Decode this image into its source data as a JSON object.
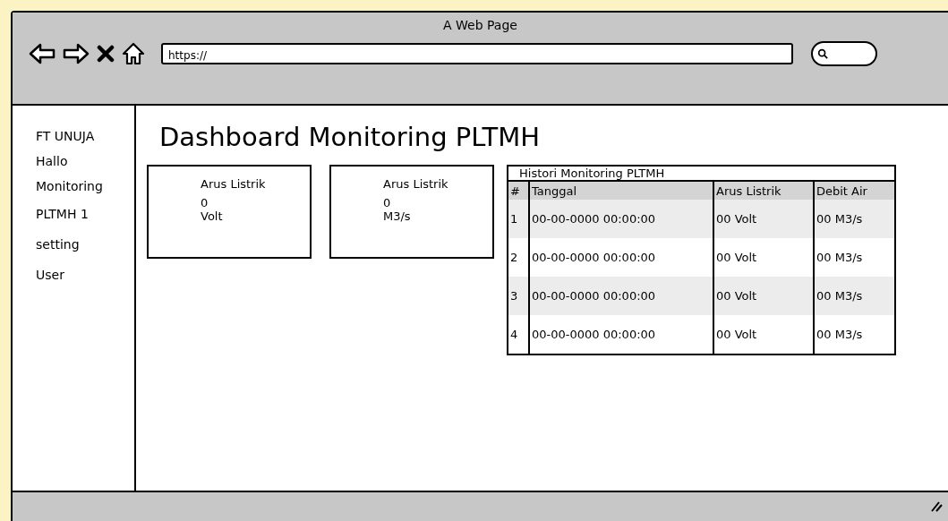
{
  "window": {
    "title": "A Web Page"
  },
  "toolbar": {
    "url": "https://"
  },
  "sidebar": {
    "items": [
      {
        "label": "FT UNUJA"
      },
      {
        "label": "Hallo"
      },
      {
        "label": "Monitoring"
      },
      {
        "label": "PLTMH 1"
      },
      {
        "label": "setting"
      },
      {
        "label": "User"
      }
    ]
  },
  "heading": "Dashboard Monitoring PLTMH",
  "cards": [
    {
      "label": "Arus Listrik",
      "value": "0",
      "unit": "Volt"
    },
    {
      "label": "Arus Listrik",
      "value": "0",
      "unit": "M3/s"
    }
  ],
  "table": {
    "title": "Histori Monitoring PLTMH",
    "columns": [
      "#",
      "Tanggal",
      "Arus Listrik",
      "Debit Air"
    ],
    "rows": [
      [
        "1",
        "00-00-0000 00:00:00",
        "00 Volt",
        "00 M3/s"
      ],
      [
        "2",
        "00-00-0000 00:00:00",
        "00 Volt",
        "00 M3/s"
      ],
      [
        "3",
        "00-00-0000 00:00:00",
        "00 Volt",
        "00 M3/s"
      ],
      [
        "4",
        "00-00-0000 00:00:00",
        "00 Volt",
        "00 M3/s"
      ]
    ]
  }
}
